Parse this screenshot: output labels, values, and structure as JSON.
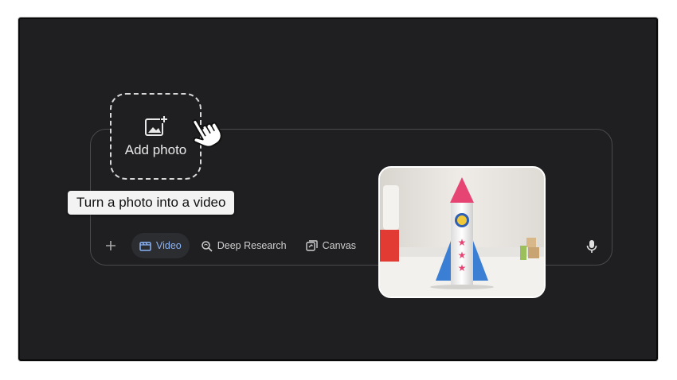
{
  "add_photo": {
    "label": "Add photo",
    "icon": "add-photo-icon"
  },
  "tooltip": {
    "text": "Turn a photo into a video"
  },
  "toolbar": {
    "plus_icon": "plus-icon",
    "chips": [
      {
        "label": "Video",
        "icon": "video-icon",
        "active": true
      },
      {
        "label": "Deep Research",
        "icon": "deep-research-icon",
        "active": false
      },
      {
        "label": "Canvas",
        "icon": "canvas-icon",
        "active": false
      }
    ],
    "mic_icon": "microphone-icon"
  },
  "colors": {
    "background": "#1f1f21",
    "accent": "#8ab4f8",
    "border": "#4a4a4d"
  }
}
